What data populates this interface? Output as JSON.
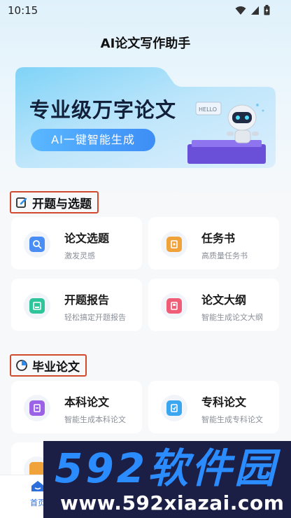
{
  "status_bar": {
    "time": "10:15"
  },
  "app": {
    "title": "AI论文写作助手"
  },
  "banner": {
    "title": "专业级万字论文",
    "pill": "AI一键智能生成",
    "robot_sign": "HELLO"
  },
  "sections": [
    {
      "label": "开题与选题",
      "cards": [
        {
          "title": "论文选题",
          "subtitle": "激发灵感",
          "icon": "search-icon",
          "color": "#4a8df5"
        },
        {
          "title": "任务书",
          "subtitle": "高质量任务书",
          "icon": "task-book-icon",
          "color": "#f0a23b"
        },
        {
          "title": "开题报告",
          "subtitle": "轻松搞定开题报告",
          "icon": "report-icon",
          "color": "#2fc59a"
        },
        {
          "title": "论文大纲",
          "subtitle": "智能生成论文大纲",
          "icon": "outline-book-icon",
          "color": "#ef5d77"
        }
      ]
    },
    {
      "label": "毕业论文",
      "cards": [
        {
          "title": "本科论文",
          "subtitle": "智能生成本科论文",
          "icon": "undergrad-thesis-icon",
          "color": "#9b62e8"
        },
        {
          "title": "专科论文",
          "subtitle": "智能生成专科论文",
          "icon": "college-thesis-icon",
          "color": "#3aa6f0"
        }
      ]
    }
  ],
  "tabbar": {
    "home_label": "首页"
  },
  "watermark": {
    "logo": "592软件园",
    "url": "www.592xiazai.com"
  }
}
